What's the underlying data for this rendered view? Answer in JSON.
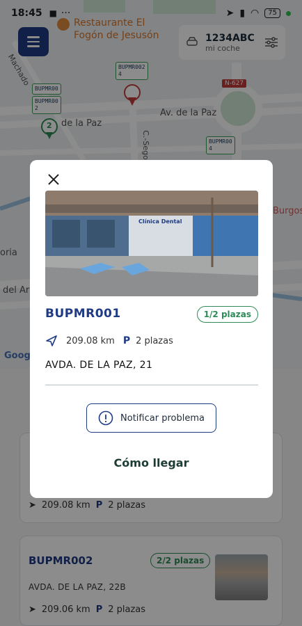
{
  "status_bar": {
    "time": "18:45",
    "dots": "···",
    "battery": "75"
  },
  "map": {
    "restaurant_name": "Restaurante El\nFogón de Jesusón",
    "street_1": "Av. de la Paz",
    "street_2": "de la Paz",
    "street_3": "Machado",
    "street_4": "C.-Sego",
    "street_5": "Burgos",
    "street_6": "del Ar",
    "street_7": "oria",
    "road_sign": "N-627",
    "tags": [
      "BUPMR002\n4",
      "BUPMR00",
      "BUPMR00\n2",
      "BUPMR00\n4"
    ],
    "cluster_count": "2",
    "google": "Google"
  },
  "vehicle": {
    "plate": "1234ABC",
    "label": "mi coche"
  },
  "modal": {
    "spot_id": "BUPMR001",
    "spots_badge": "1/2 plazas",
    "distance": "209.08 km",
    "parking_letter": "P",
    "spots_text": "2 plazas",
    "address": "AVDA. DE LA PAZ, 21",
    "photo_sign": "Clínica Dental",
    "notify_label": "Notificar problema",
    "directions_label": "Cómo llegar"
  },
  "list": {
    "card1": {
      "distance": "209.08 km",
      "parking_letter": "P",
      "spots_text": "2 plazas"
    },
    "card2": {
      "spot_id": "BUPMR002",
      "badge": "2/2 plazas",
      "address": "AVDA. DE LA PAZ, 22B",
      "distance": "209.06 km",
      "parking_letter": "P",
      "spots_text": "2 plazas"
    }
  },
  "colors": {
    "primary": "#1e3b84",
    "green": "#2e8b57",
    "overlay": "rgba(0,0,0,0.45)"
  }
}
